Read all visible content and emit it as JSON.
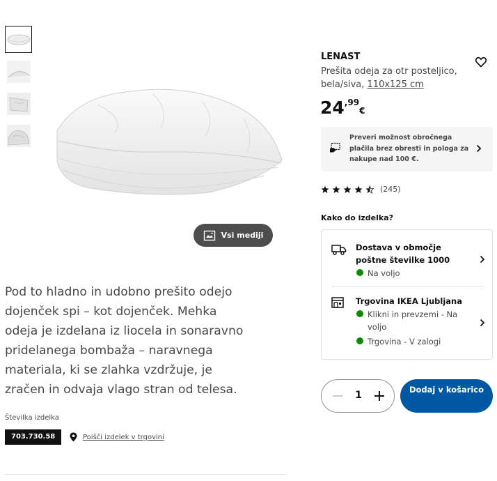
{
  "gallery": {
    "thumbnail_count": 4,
    "all_media_label": "Vsi mediji"
  },
  "description": "Pod to hladno in udobno prešito odejo dojenček spi – kot dojenček. Mehka odeja je izdelana iz liocela in sonaravno pridelanega bombaža – naravnega materiala, ki se zlahka vzdržuje, je zračen in odvaja vlago stran od telesa.",
  "article": {
    "label": "Številka izdelka",
    "number": "703.730.58",
    "find_in_store": "Poišči izdelek v trgovini"
  },
  "product": {
    "name": "LENAST",
    "desc": "Prešita odeja za otr posteljico, bela/siva,",
    "size": "110x125 cm",
    "price_int": "24",
    "price_dec": ",99",
    "currency": "€"
  },
  "financing": {
    "text": "Preveri možnost obročnega plačila brez obresti in pologa za nakupe nad 100 €."
  },
  "rating": {
    "stars": "★★★★★",
    "value": 4.5,
    "count": "(245)"
  },
  "delivery": {
    "heading": "Kako do izdelka?",
    "home": {
      "title": "Dostava v območje poštne številke 1000",
      "status": "Na voljo"
    },
    "store": {
      "title": "Trgovina IKEA Ljubljana",
      "click_collect": "Klikni in prevzemi - Na voljo",
      "in_store": "Trgovina - V zalogi"
    }
  },
  "cart": {
    "quantity": "1",
    "add_label": "Dodaj v košarico"
  },
  "colors": {
    "primary_blue": "#0058a3",
    "available_green": "#0a8a00",
    "text_gray": "#484848"
  },
  "icons": [
    "heart-icon",
    "gallery-icon",
    "location-pin-icon",
    "credit-card-icon",
    "chevron-right-icon",
    "truck-icon",
    "store-icon",
    "minus-icon",
    "plus-icon"
  ]
}
